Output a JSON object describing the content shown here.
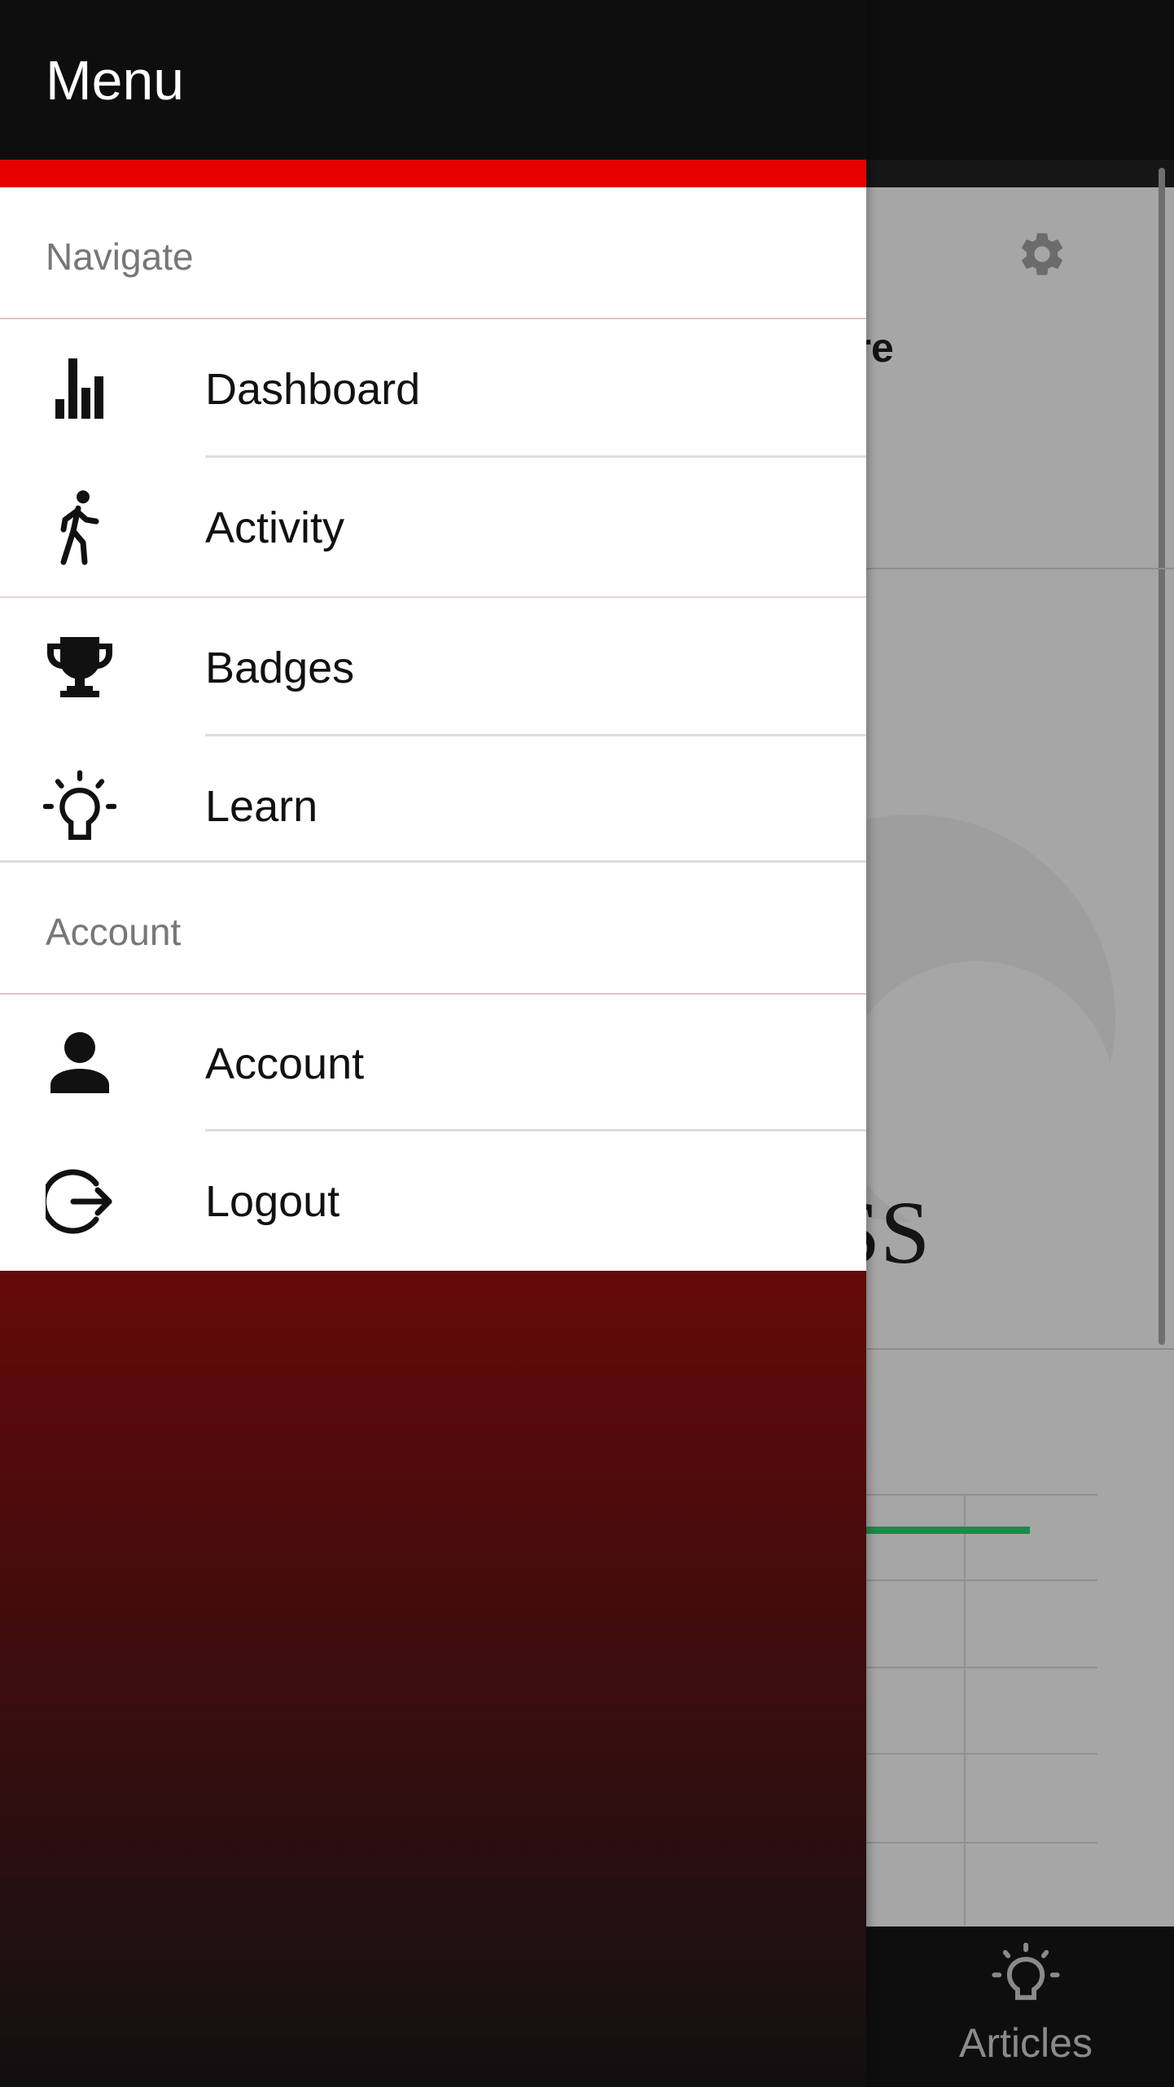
{
  "background": {
    "card_title_partial": "ure",
    "gauge_text_partial": "SS",
    "bottom_nav": {
      "articles_label": "Articles",
      "icon": "lightbulb-icon"
    }
  },
  "drawer": {
    "title": "Menu",
    "sections": [
      {
        "header": "Navigate",
        "items": [
          {
            "label": "Dashboard",
            "icon": "bar-chart-icon"
          },
          {
            "label": "Activity",
            "icon": "walking-person-icon"
          },
          {
            "label": "Badges",
            "icon": "trophy-icon"
          },
          {
            "label": "Learn",
            "icon": "lightbulb-icon"
          }
        ]
      },
      {
        "header": "Account",
        "items": [
          {
            "label": "Account",
            "icon": "person-icon"
          },
          {
            "label": "Logout",
            "icon": "logout-icon"
          }
        ]
      }
    ]
  },
  "colors": {
    "accent_red": "#e60000",
    "drawer_gradient_top": "#650909",
    "drawer_gradient_bottom": "#110e0f",
    "progress_green": "#1d8a4c"
  }
}
